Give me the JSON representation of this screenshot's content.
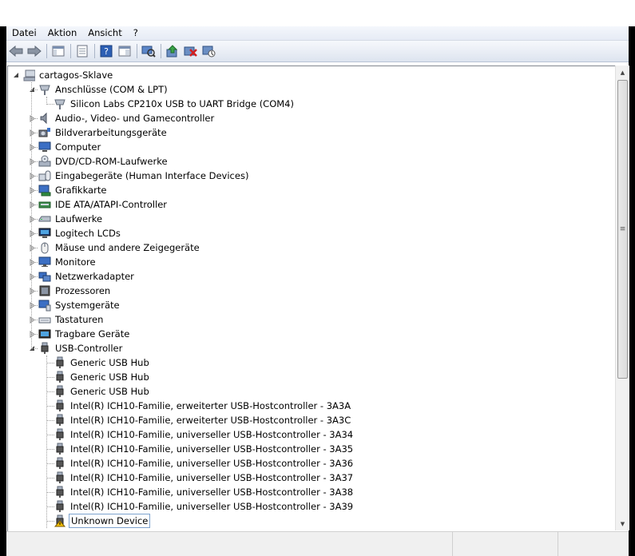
{
  "menu": [
    "Datei",
    "Aktion",
    "Ansicht",
    "?"
  ],
  "toolbar": {
    "buttons": [
      "back-arrow-icon",
      "forward-arrow-icon",
      "|",
      "show-hide-tree-icon",
      "|",
      "properties-icon",
      "|",
      "help-icon",
      "view-icon",
      "|",
      "scan-hardware-icon",
      "|",
      "update-driver-icon",
      "uninstall-icon",
      "disable-icon"
    ]
  },
  "tree": {
    "root": "cartagos-Sklave",
    "items": [
      {
        "label": "Anschlüsse (COM & LPT)",
        "level": 1,
        "expander": "open",
        "icon": "port-icon"
      },
      {
        "label": "Silicon Labs CP210x USB to UART Bridge (COM4)",
        "level": 2,
        "expander": "none",
        "icon": "port-icon"
      },
      {
        "label": "Audio-, Video- und Gamecontroller",
        "level": 1,
        "expander": "closed",
        "icon": "speaker-icon"
      },
      {
        "label": "Bildverarbeitungsgeräte",
        "level": 1,
        "expander": "closed",
        "icon": "camera-icon"
      },
      {
        "label": "Computer",
        "level": 1,
        "expander": "closed",
        "icon": "computer-icon"
      },
      {
        "label": "DVD/CD-ROM-Laufwerke",
        "level": 1,
        "expander": "closed",
        "icon": "dvd-icon"
      },
      {
        "label": "Eingabegeräte (Human Interface Devices)",
        "level": 1,
        "expander": "closed",
        "icon": "hid-icon"
      },
      {
        "label": "Grafikkarte",
        "level": 1,
        "expander": "closed",
        "icon": "display-adapter-icon"
      },
      {
        "label": "IDE ATA/ATAPI-Controller",
        "level": 1,
        "expander": "closed",
        "icon": "ide-icon"
      },
      {
        "label": "Laufwerke",
        "level": 1,
        "expander": "closed",
        "icon": "disk-drive-icon"
      },
      {
        "label": "Logitech LCDs",
        "level": 1,
        "expander": "closed",
        "icon": "lcd-icon"
      },
      {
        "label": "Mäuse und andere Zeigegeräte",
        "level": 1,
        "expander": "closed",
        "icon": "mouse-icon"
      },
      {
        "label": "Monitore",
        "level": 1,
        "expander": "closed",
        "icon": "monitor-icon"
      },
      {
        "label": "Netzwerkadapter",
        "level": 1,
        "expander": "closed",
        "icon": "network-icon"
      },
      {
        "label": "Prozessoren",
        "level": 1,
        "expander": "closed",
        "icon": "processor-icon"
      },
      {
        "label": "Systemgeräte",
        "level": 1,
        "expander": "closed",
        "icon": "system-icon"
      },
      {
        "label": "Tastaturen",
        "level": 1,
        "expander": "closed",
        "icon": "keyboard-icon"
      },
      {
        "label": "Tragbare Geräte",
        "level": 1,
        "expander": "closed",
        "icon": "portable-device-icon"
      },
      {
        "label": "USB-Controller",
        "level": 1,
        "expander": "open",
        "icon": "usb-icon"
      },
      {
        "label": "Generic USB Hub",
        "level": 2,
        "expander": "none",
        "icon": "usb-icon"
      },
      {
        "label": "Generic USB Hub",
        "level": 2,
        "expander": "none",
        "icon": "usb-icon"
      },
      {
        "label": "Generic USB Hub",
        "level": 2,
        "expander": "none",
        "icon": "usb-icon"
      },
      {
        "label": "Intel(R) ICH10-Familie, erweiterter USB-Hostcontroller - 3A3A",
        "level": 2,
        "expander": "none",
        "icon": "usb-icon"
      },
      {
        "label": "Intel(R) ICH10-Familie, erweiterter USB-Hostcontroller - 3A3C",
        "level": 2,
        "expander": "none",
        "icon": "usb-icon"
      },
      {
        "label": "Intel(R) ICH10-Familie, universeller USB-Hostcontroller - 3A34",
        "level": 2,
        "expander": "none",
        "icon": "usb-icon"
      },
      {
        "label": "Intel(R) ICH10-Familie, universeller USB-Hostcontroller - 3A35",
        "level": 2,
        "expander": "none",
        "icon": "usb-icon"
      },
      {
        "label": "Intel(R) ICH10-Familie, universeller USB-Hostcontroller - 3A36",
        "level": 2,
        "expander": "none",
        "icon": "usb-icon"
      },
      {
        "label": "Intel(R) ICH10-Familie, universeller USB-Hostcontroller - 3A37",
        "level": 2,
        "expander": "none",
        "icon": "usb-icon"
      },
      {
        "label": "Intel(R) ICH10-Familie, universeller USB-Hostcontroller - 3A38",
        "level": 2,
        "expander": "none",
        "icon": "usb-icon"
      },
      {
        "label": "Intel(R) ICH10-Familie, universeller USB-Hostcontroller - 3A39",
        "level": 2,
        "expander": "none",
        "icon": "usb-icon"
      },
      {
        "label": "Unknown Device",
        "level": 2,
        "expander": "none",
        "icon": "usb-warning-icon",
        "selected": true
      }
    ]
  },
  "colors": {
    "selection_border": "#7da2ce",
    "warning": "#f5c000",
    "tree_line": "#a0a0a0"
  }
}
